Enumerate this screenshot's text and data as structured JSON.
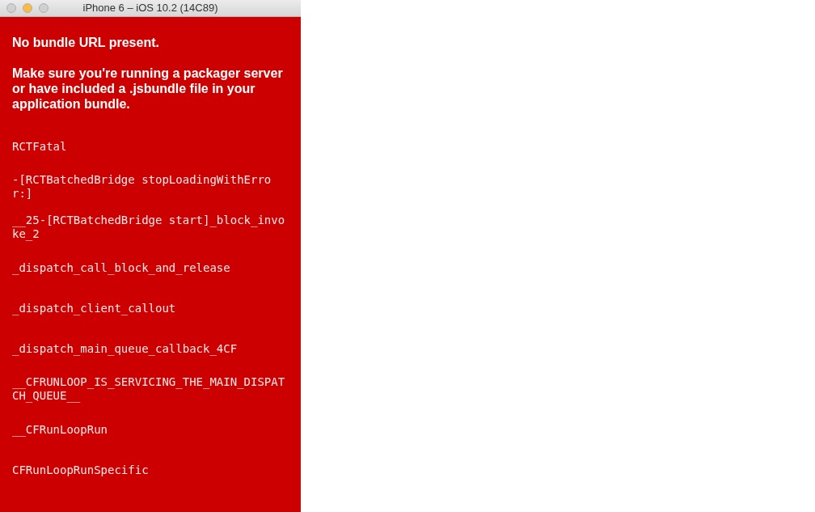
{
  "window": {
    "title": "iPhone 6 – iOS 10.2 (14C89)",
    "buttons": [
      {
        "kind": "close",
        "enabled": false
      },
      {
        "kind": "minimize",
        "enabled": true
      },
      {
        "kind": "zoom",
        "enabled": false
      }
    ]
  },
  "error": {
    "title": "No bundle URL present.",
    "message": "Make sure you're running a packager server or have included a .jsbundle file in your application bundle.",
    "stack": [
      "RCTFatal",
      "-[RCTBatchedBridge stopLoadingWithError:]",
      "__25-[RCTBatchedBridge start]_block_invoke_2",
      "_dispatch_call_block_and_release",
      "_dispatch_client_callout",
      "_dispatch_main_queue_callback_4CF",
      "__CFRUNLOOP_IS_SERVICING_THE_MAIN_DISPATCH_QUEUE__",
      "__CFRunLoopRun",
      "CFRunLoopRunSpecific"
    ]
  }
}
